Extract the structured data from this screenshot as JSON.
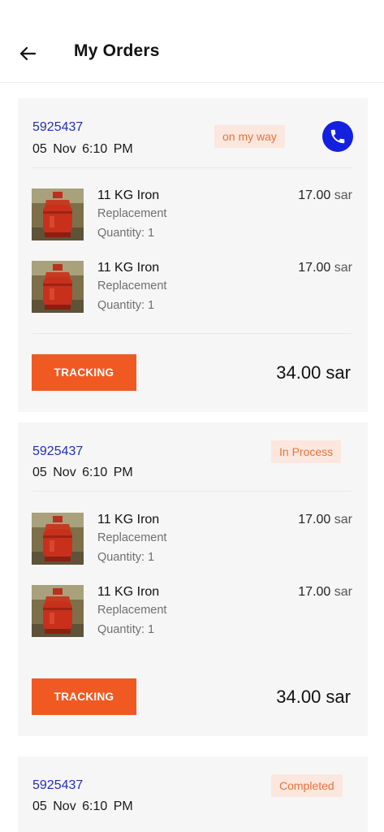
{
  "header": {
    "title": "My Orders",
    "back_icon": "arrow-left-icon"
  },
  "colors": {
    "accent": "#f05a22",
    "link": "#2030b8",
    "call": "#1420e0",
    "badge_bg": "#fbe7de",
    "badge_text": "#e8733c"
  },
  "orders": [
    {
      "id": "5925437",
      "date": "05 Nov  6:10 PM",
      "status": "on my way",
      "call_icon": "phone-icon",
      "items": [
        {
          "name": "11 KG Iron",
          "type": "Replacement",
          "qty": "Quantity: 1",
          "price": "17.00",
          "currency": "sar",
          "image_icon": "gas-cylinder-image"
        },
        {
          "name": "11 KG Iron",
          "type": "Replacement",
          "qty": "Quantity: 1",
          "price": "17.00",
          "currency": "sar",
          "image_icon": "gas-cylinder-image"
        }
      ],
      "button": "TRACKING",
      "total": "34.00 sar"
    },
    {
      "id": "5925437",
      "date": "05 Nov  6:10 PM",
      "status": "In Process",
      "items": [
        {
          "name": "11 KG Iron",
          "type": "Replacement",
          "qty": "Quantity: 1",
          "price": "17.00",
          "currency": "sar",
          "image_icon": "gas-cylinder-image"
        },
        {
          "name": "11 KG Iron",
          "type": "Replacement",
          "qty": "Quantity: 1",
          "price": "17.00",
          "currency": "sar",
          "image_icon": "gas-cylinder-image"
        }
      ],
      "button": "TRACKING",
      "total": "34.00 sar"
    },
    {
      "id": "5925437",
      "date": "05 Nov  6:10 PM",
      "status": "Completed"
    }
  ]
}
